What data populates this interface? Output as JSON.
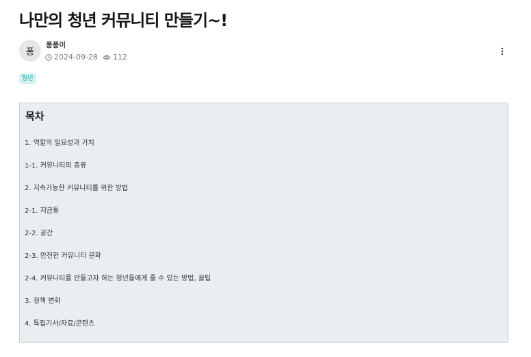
{
  "post": {
    "title": "나만의 청년 커뮤니티 만들기~!",
    "author": {
      "avatar_text": "퐁",
      "name": "퐁퐁이"
    },
    "date": "2024-09-28",
    "views": "112",
    "tag": "청년"
  },
  "icons": {
    "date": "clock-icon",
    "views": "eye-icon",
    "more": "more-vertical-icon"
  },
  "toc": {
    "heading": "목차",
    "items": [
      "1. 역할의 필요성과 가치",
      "1-1. 커뮤니티의 종류",
      "2. 지속가능한 커뮤니티를 위한 방법",
      "2-1. 지금통",
      "2-2. 공간",
      "2-3. 안전한 커뮤니티 문화",
      "2-4. 커뮤니티를 만들고자 하는 청년들에게 줄 수 있는 방법, 꿀팁",
      "3. 정책 변화",
      "4. 특집기사/자료/콘텐츠"
    ]
  },
  "colors": {
    "tag_bg": "#d6f3f1",
    "tag_text": "#19a3a0",
    "toc_bg": "#eaeef0",
    "toc_border": "#c9cfd3"
  }
}
